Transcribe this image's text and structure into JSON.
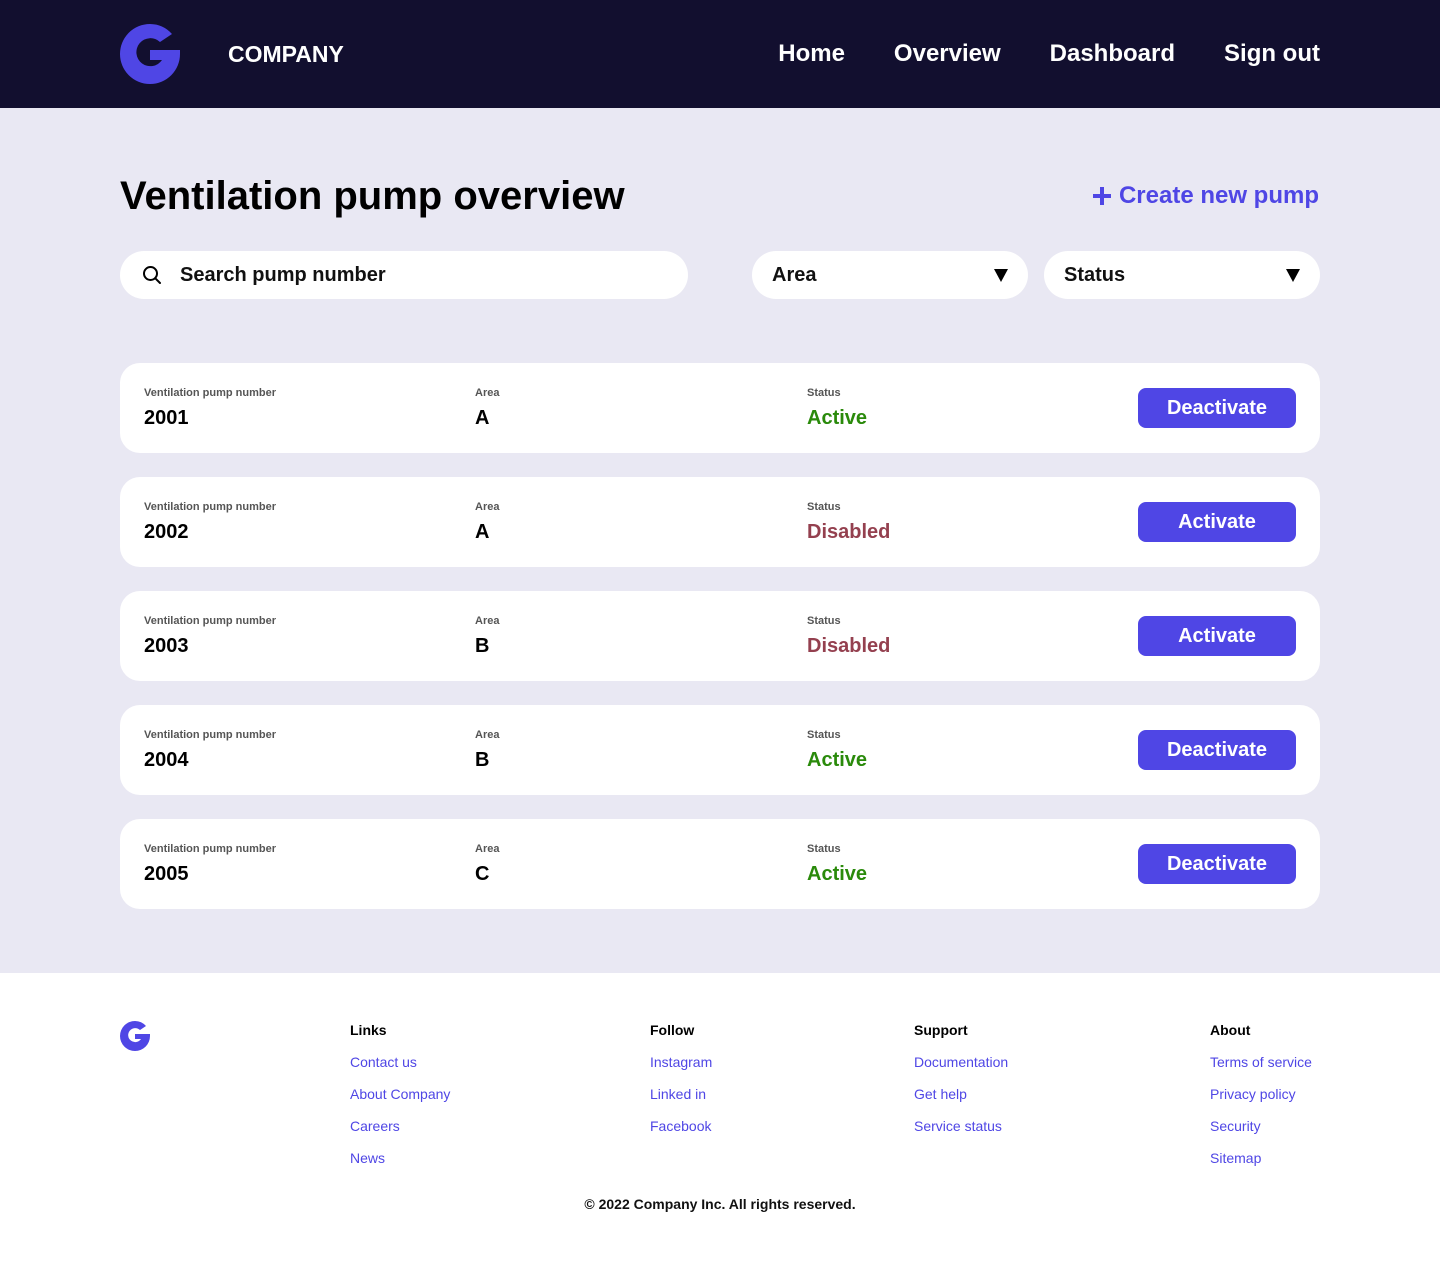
{
  "header": {
    "brand": "COMPANY",
    "nav": [
      "Home",
      "Overview",
      "Dashboard",
      "Sign out"
    ]
  },
  "page": {
    "title": "Ventilation pump overview",
    "create_label": "Create new pump",
    "search_placeholder": "Search pump number",
    "filter_area": "Area",
    "filter_status": "Status"
  },
  "labels": {
    "pump_number": "Ventilation pump number",
    "area": "Area",
    "status": "Status"
  },
  "pumps": [
    {
      "number": "2001",
      "area": "A",
      "status": "Active",
      "action": "Deactivate"
    },
    {
      "number": "2002",
      "area": "A",
      "status": "Disabled",
      "action": "Activate"
    },
    {
      "number": "2003",
      "area": "B",
      "status": "Disabled",
      "action": "Activate"
    },
    {
      "number": "2004",
      "area": "B",
      "status": "Active",
      "action": "Deactivate"
    },
    {
      "number": "2005",
      "area": "C",
      "status": "Active",
      "action": "Deactivate"
    }
  ],
  "colors": {
    "accent": "#4f46e5",
    "header_bg": "#120f2f",
    "main_bg": "#e9e8f3",
    "active": "#2a8a0b",
    "disabled": "#94404f"
  },
  "footer": {
    "columns": [
      {
        "heading": "Links",
        "items": [
          "Contact us",
          "About Company",
          "Careers",
          "News"
        ]
      },
      {
        "heading": "Follow",
        "items": [
          "Instagram",
          "Linked in",
          "Facebook"
        ]
      },
      {
        "heading": "Support",
        "items": [
          "Documentation",
          "Get help",
          "Service status"
        ]
      },
      {
        "heading": "About",
        "items": [
          "Terms of service",
          "Privacy policy",
          "Security",
          "Sitemap"
        ]
      }
    ],
    "copyright": "© 2022 Company Inc. All rights reserved."
  }
}
